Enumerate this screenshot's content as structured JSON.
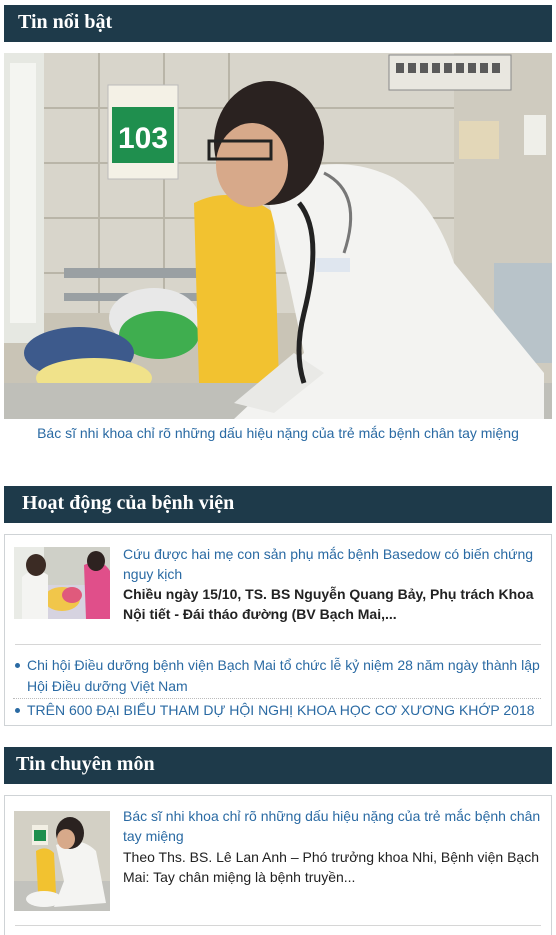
{
  "sections": {
    "featured": {
      "title": "Tin nổi bật"
    },
    "hospital": {
      "title": "Hoạt động của bệnh viện"
    },
    "professional": {
      "title": "Tin chuyên môn"
    }
  },
  "featured": {
    "caption": "Bác sĩ nhi khoa chỉ rõ những dấu hiệu nặng của trẻ mắc bệnh chân tay miệng",
    "room_number": "103"
  },
  "hospital": {
    "story": {
      "title": "Cứu được hai mẹ con sản phụ mắc bệnh Basedow có biến chứng nguy kịch",
      "summary": "Chiều ngày 15/10, TS. BS Nguyễn Quang Bảy, Phụ trách Khoa Nội tiết - Đái tháo đường (BV Bạch Mai,..."
    },
    "links": [
      "Chi hội Điều dưỡng bệnh viện Bạch Mai tổ chức lễ kỷ niệm 28 năm ngày thành lập Hội Điều dưỡng Việt Nam",
      "TRÊN 600 ĐẠI BIỂU THAM DỰ HỘI NGHỊ KHOA HỌC CƠ XƯƠNG KHỚP 2018"
    ]
  },
  "professional": {
    "story": {
      "title": "Bác sĩ nhi khoa chỉ rõ những dấu hiệu nặng của trẻ mắc bệnh chân tay miệng",
      "summary": "Theo Ths. BS. Lê Lan Anh – Phó trưởng khoa Nhi, Bệnh viện Bạch Mai: Tay chân miệng là bệnh truyền..."
    }
  },
  "colors": {
    "header_bg": "#1e3a4a",
    "link": "#2a6aa3"
  }
}
